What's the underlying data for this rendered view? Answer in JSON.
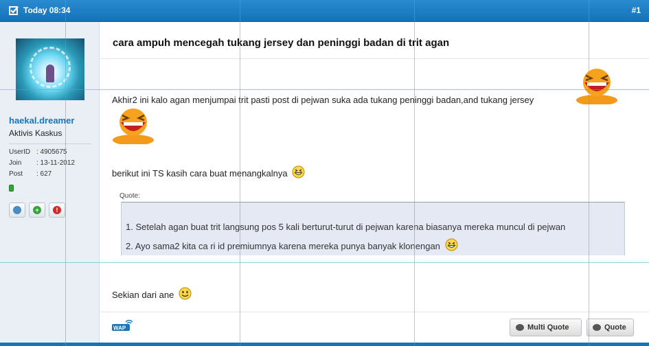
{
  "header": {
    "date": "Today 08:34",
    "post_number": "#1"
  },
  "user": {
    "name": "haekal.dreamer",
    "rank": "Aktivis Kaskus",
    "userid_label": "UserID",
    "userid_value": ": 4905675",
    "join_label": "Join",
    "join_value": ": 13-11-2012",
    "post_label": "Post",
    "post_value": ": 627",
    "status_color": "#2faa2f"
  },
  "post": {
    "title": "cara ampuh mencegah tukang jersey dan peninggi badan di trit agan",
    "paragraph1": "Akhir2 ini kalo agan menjumpai trit pasti post di pejwan suka ada tukang peninggi badan,and tukang jersey",
    "paragraph2": "berikut ini TS kasih cara buat menangkalnya",
    "quote_label": "Quote:",
    "quote_line1": "1. Setelah agan buat trit langsung pos 5 kali berturut-turut di pejwan karena biasanya mereka muncul di pejwan",
    "quote_line2": "2. Ayo sama2 kita ca ri id premiumnya karena mereka punya banyak klonengan",
    "paragraph3": "Sekian dari ane"
  },
  "actions": {
    "multi_quote": "Multi Quote",
    "quote": "Quote"
  },
  "colors": {
    "accent": "#1573b8",
    "username": "#1a74b8",
    "quote_bg": "#e5e9f4"
  },
  "icons": [
    "checkbox-icon",
    "laugh-emoticon",
    "grin-emoticon",
    "smile-emoticon",
    "wap-icon",
    "speech-bubbles-icon",
    "speech-bubble-icon"
  ]
}
